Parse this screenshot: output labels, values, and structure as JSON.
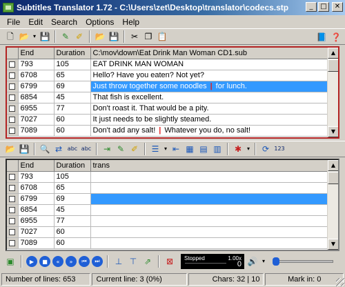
{
  "window": {
    "title": "Subtitles Translator 1.72 - C:\\Users\\zet\\Desktop\\translator\\codecs.stp"
  },
  "menu": [
    "File",
    "Edit",
    "Search",
    "Options",
    "Help"
  ],
  "top_grid": {
    "headers": [
      "End",
      "Duration",
      "C:\\mov\\down\\Eat Drink Man Woman CD1.sub"
    ],
    "rows": [
      {
        "end": "793",
        "duration": "105",
        "text": "EAT DRINK MAN WOMAN"
      },
      {
        "end": "6708",
        "duration": "65",
        "text": "Hello? Have you eaten? Not yet?"
      },
      {
        "end": "6799",
        "duration": "69",
        "text_a": "Just throw together some noodles",
        "text_b": "for lunch."
      },
      {
        "end": "6854",
        "duration": "45",
        "text": "That fish is excellent."
      },
      {
        "end": "6955",
        "duration": "77",
        "text": "Don't roast it. That would be a pity."
      },
      {
        "end": "7027",
        "duration": "60",
        "text": "It just needs to be slightly steamed."
      },
      {
        "end": "7089",
        "duration": "60",
        "text_a": "Don't add any salt!",
        "text_b": "Whatever you do, no salt!"
      }
    ],
    "separator": "|"
  },
  "bottom_grid": {
    "headers": [
      "End",
      "Duration",
      "trans"
    ],
    "rows": [
      {
        "end": "793",
        "duration": "105"
      },
      {
        "end": "6708",
        "duration": "65"
      },
      {
        "end": "6799",
        "duration": "69"
      },
      {
        "end": "6854",
        "duration": "45"
      },
      {
        "end": "6955",
        "duration": "77"
      },
      {
        "end": "7027",
        "duration": "60"
      },
      {
        "end": "7089",
        "duration": "60"
      }
    ]
  },
  "player": {
    "status": "Stopped",
    "rate": "1.00x",
    "counter": "0"
  },
  "statusbar": {
    "lines": "Number of lines: 653",
    "current": "Current line: 3 (0%)",
    "chars": "Chars: 32 | 10",
    "mark": "Mark in: 0"
  },
  "colors": {
    "selection": "#3399ff",
    "title_bar": "#0a246a",
    "split_marker": "#e02020",
    "active_border": "#b22222"
  }
}
